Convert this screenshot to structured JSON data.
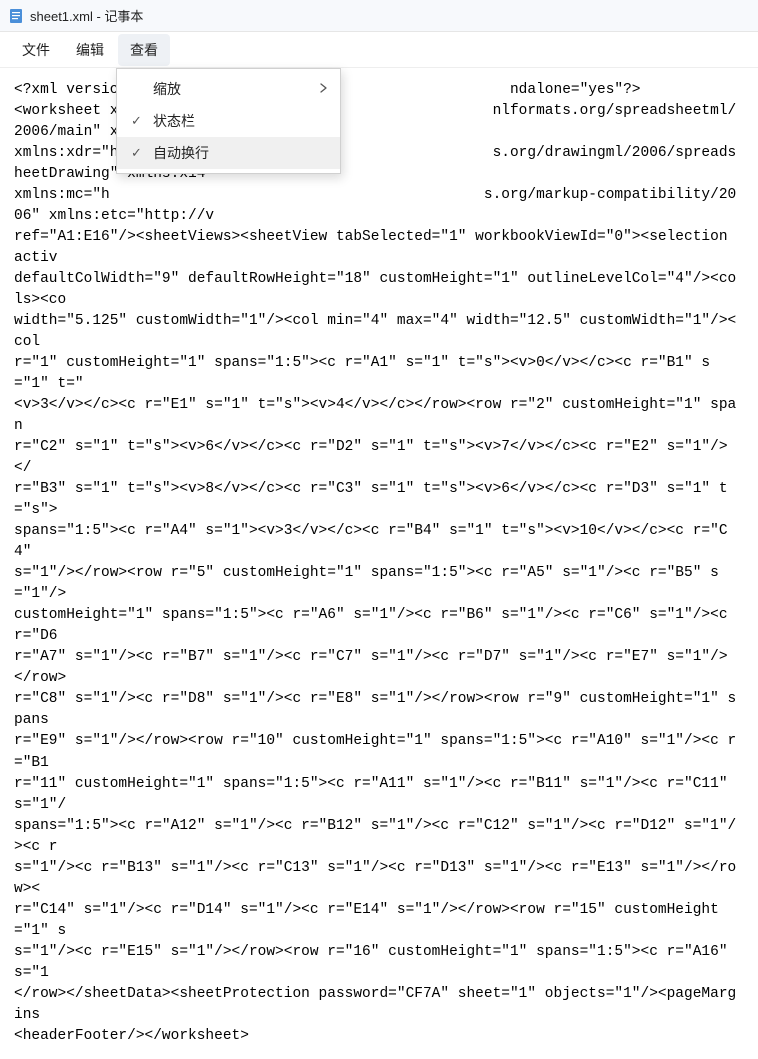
{
  "window": {
    "title": "sheet1.xml - 记事本"
  },
  "menubar": {
    "items": [
      "文件",
      "编辑",
      "查看"
    ]
  },
  "dropdown": {
    "items": [
      {
        "check": "",
        "label": "缩放",
        "submenu": true
      },
      {
        "check": "✓",
        "label": "状态栏",
        "submenu": false
      },
      {
        "check": "✓",
        "label": "自动换行",
        "submenu": false
      }
    ]
  },
  "document": {
    "text": "<?xml version                                            ndalone=\"yes\"?>\n<worksheet x                                           nlformats.org/spreadsheetml/2006/main\" xmlns:r=\"htt\nxmlns:xdr=\"h                                           s.org/drawingml/2006/spreadsheetDrawing\" xmlns:x14\nxmlns:mc=\"h                                           s.org/markup-compatibility/2006\" xmlns:etc=\"http://v\nref=\"A1:E16\"/><sheetViews><sheetView tabSelected=\"1\" workbookViewId=\"0\"><selection activ\ndefaultColWidth=\"9\" defaultRowHeight=\"18\" customHeight=\"1\" outlineLevelCol=\"4\"/><cols><co\nwidth=\"5.125\" customWidth=\"1\"/><col min=\"4\" max=\"4\" width=\"12.5\" customWidth=\"1\"/><col\nr=\"1\" customHeight=\"1\" spans=\"1:5\"><c r=\"A1\" s=\"1\" t=\"s\"><v>0</v></c><c r=\"B1\" s=\"1\" t=\"\n<v>3</v></c><c r=\"E1\" s=\"1\" t=\"s\"><v>4</v></c></row><row r=\"2\" customHeight=\"1\" span\nr=\"C2\" s=\"1\" t=\"s\"><v>6</v></c><c r=\"D2\" s=\"1\" t=\"s\"><v>7</v></c><c r=\"E2\" s=\"1\"/></\nr=\"B3\" s=\"1\" t=\"s\"><v>8</v></c><c r=\"C3\" s=\"1\" t=\"s\"><v>6</v></c><c r=\"D3\" s=\"1\" t=\"s\">\nspans=\"1:5\"><c r=\"A4\" s=\"1\"><v>3</v></c><c r=\"B4\" s=\"1\" t=\"s\"><v>10</v></c><c r=\"C4\"\ns=\"1\"/></row><row r=\"5\" customHeight=\"1\" spans=\"1:5\"><c r=\"A5\" s=\"1\"/><c r=\"B5\" s=\"1\"/>\ncustomHeight=\"1\" spans=\"1:5\"><c r=\"A6\" s=\"1\"/><c r=\"B6\" s=\"1\"/><c r=\"C6\" s=\"1\"/><c r=\"D6\nr=\"A7\" s=\"1\"/><c r=\"B7\" s=\"1\"/><c r=\"C7\" s=\"1\"/><c r=\"D7\" s=\"1\"/><c r=\"E7\" s=\"1\"/></row>\nr=\"C8\" s=\"1\"/><c r=\"D8\" s=\"1\"/><c r=\"E8\" s=\"1\"/></row><row r=\"9\" customHeight=\"1\" spans\nr=\"E9\" s=\"1\"/></row><row r=\"10\" customHeight=\"1\" spans=\"1:5\"><c r=\"A10\" s=\"1\"/><c r=\"B1\nr=\"11\" customHeight=\"1\" spans=\"1:5\"><c r=\"A11\" s=\"1\"/><c r=\"B11\" s=\"1\"/><c r=\"C11\" s=\"1\"/\nspans=\"1:5\"><c r=\"A12\" s=\"1\"/><c r=\"B12\" s=\"1\"/><c r=\"C12\" s=\"1\"/><c r=\"D12\" s=\"1\"/><c r\ns=\"1\"/><c r=\"B13\" s=\"1\"/><c r=\"C13\" s=\"1\"/><c r=\"D13\" s=\"1\"/><c r=\"E13\" s=\"1\"/></row><\nr=\"C14\" s=\"1\"/><c r=\"D14\" s=\"1\"/><c r=\"E14\" s=\"1\"/></row><row r=\"15\" customHeight=\"1\" s\ns=\"1\"/><c r=\"E15\" s=\"1\"/></row><row r=\"16\" customHeight=\"1\" spans=\"1:5\"><c r=\"A16\" s=\"1\n</row></sheetData><sheetProtection password=\"CF7A\" sheet=\"1\" objects=\"1\"/><pageMargins\n<headerFooter/></worksheet>"
  }
}
